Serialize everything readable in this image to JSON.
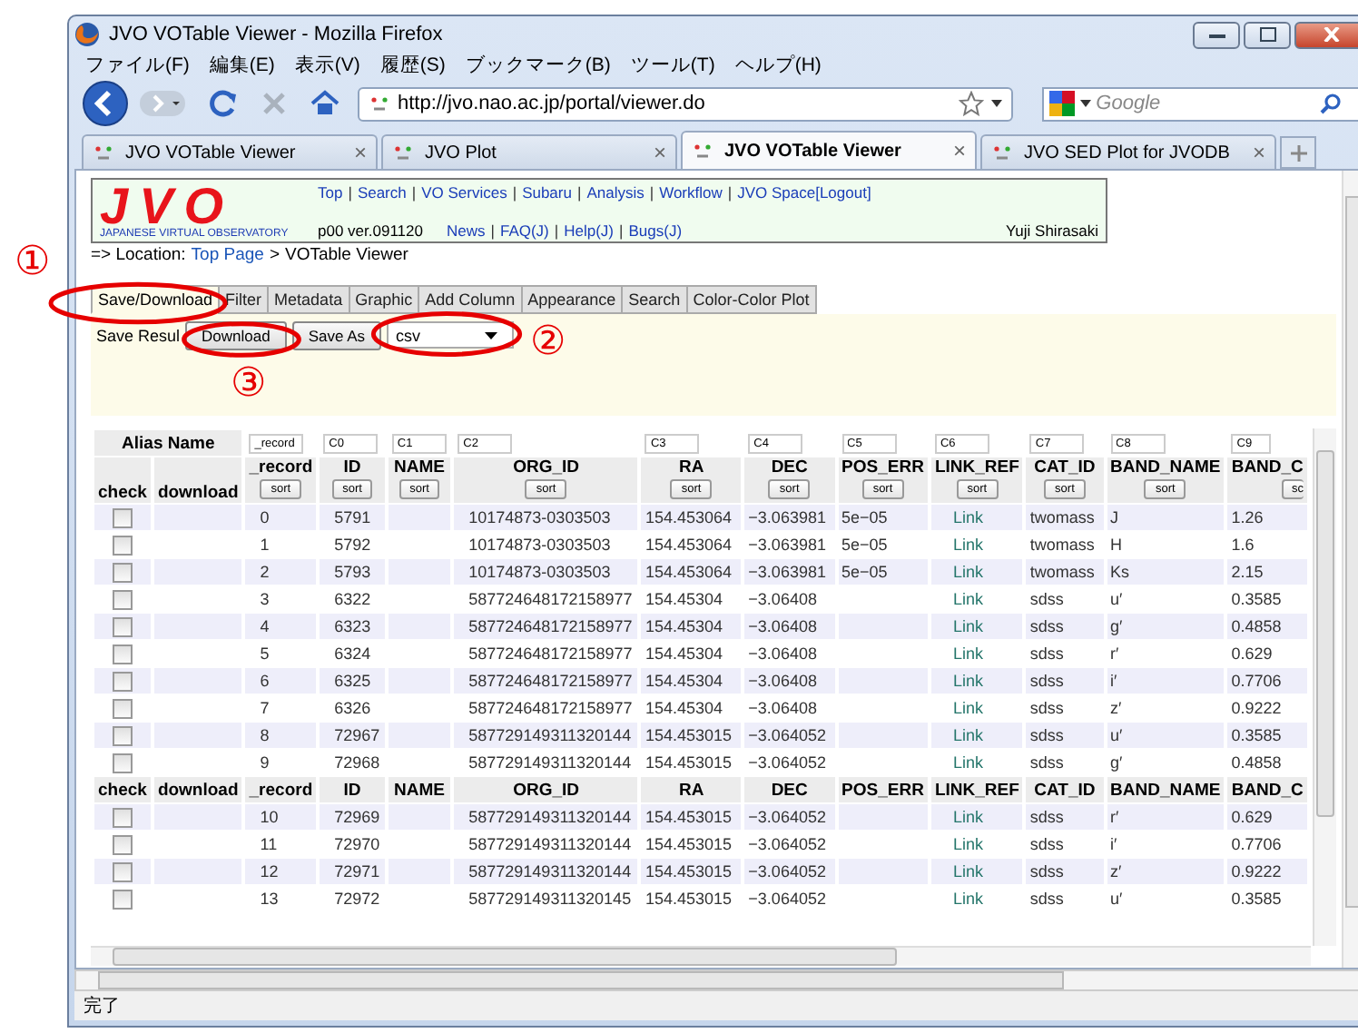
{
  "window": {
    "title": "JVO VOTable Viewer - Mozilla Firefox"
  },
  "menu": [
    "ファイル(F)",
    "編集(E)",
    "表示(V)",
    "履歴(S)",
    "ブックマーク(B)",
    "ツール(T)",
    "ヘルプ(H)"
  ],
  "address": {
    "value": "http://jvo.nao.ac.jp/portal/viewer.do"
  },
  "search": {
    "placeholder": "Google"
  },
  "browser_tabs": [
    {
      "label": "JVO VOTable Viewer",
      "close": "×",
      "selected": false
    },
    {
      "label": "JVO Plot",
      "close": "×",
      "selected": false
    },
    {
      "label": "JVO VOTable Viewer",
      "close": "×",
      "selected": true
    },
    {
      "label": "JVO SED Plot for JVODB",
      "close": "×",
      "selected": false
    }
  ],
  "site": {
    "logo": "JVO",
    "logo_subtitle": "JAPANESE VIRTUAL OBSERVATORY",
    "separator": "|",
    "nav_links": [
      "Top",
      "Search",
      "VO Services",
      "Subaru",
      "Analysis",
      "Workflow",
      "JVO Space[Logout]"
    ],
    "version": "p00 ver.091120",
    "sub_links": [
      "News",
      "FAQ(J)",
      "Help(J)",
      "Bugs(J)"
    ],
    "user": "Yuji Shirasaki"
  },
  "breadcrumb": {
    "prefix": "=> Location:",
    "items": [
      "Top Page",
      "VOTable Viewer"
    ],
    "separator": ">"
  },
  "tabs": [
    {
      "label": "Save/Download",
      "selected": true
    },
    {
      "label": "Filter",
      "selected": false
    },
    {
      "label": "Metadata",
      "selected": false
    },
    {
      "label": "Graphic",
      "selected": false
    },
    {
      "label": "Add Column",
      "selected": false
    },
    {
      "label": "Appearance",
      "selected": false
    },
    {
      "label": "Search",
      "selected": false
    },
    {
      "label": "Color-Color Plot",
      "selected": false
    }
  ],
  "save": {
    "label": "Save Resul",
    "download": "Download",
    "save_as": "Save As",
    "format": "csv"
  },
  "table": {
    "alias_label": "Alias Name",
    "fixed_headers": [
      "check",
      "download"
    ],
    "columns": [
      {
        "alias": "_record",
        "label": "_record",
        "sort": "sort"
      },
      {
        "alias": "C0",
        "label": "ID",
        "sort": "sort"
      },
      {
        "alias": "C1",
        "label": "NAME",
        "sort": "sort"
      },
      {
        "alias": "C2",
        "label": "ORG_ID",
        "sort": "sort"
      },
      {
        "alias": "C3",
        "label": "RA",
        "sort": "sort"
      },
      {
        "alias": "C4",
        "label": "DEC",
        "sort": "sort"
      },
      {
        "alias": "C5",
        "label": "POS_ERR",
        "sort": "sort"
      },
      {
        "alias": "C6",
        "label": "LINK_REF",
        "sort": "sort"
      },
      {
        "alias": "C7",
        "label": "CAT_ID",
        "sort": "sort"
      },
      {
        "alias": "C8",
        "label": "BAND_NAME",
        "sort": "sort"
      },
      {
        "alias": "C9",
        "label": "BAND_C",
        "sort": "sc"
      }
    ],
    "rows": [
      {
        "kind": "data",
        "checked": false,
        "record": "0",
        "id": "5791",
        "org_id": "10174873-0303503",
        "ra": "154.453064",
        "dec": "−3.063981",
        "pos_err": "5e−05",
        "link_ref": "Link",
        "cat_id": "twomass",
        "band_name": "J",
        "band_c": "1.26"
      },
      {
        "kind": "data",
        "checked": false,
        "record": "1",
        "id": "5792",
        "org_id": "10174873-0303503",
        "ra": "154.453064",
        "dec": "−3.063981",
        "pos_err": "5e−05",
        "link_ref": "Link",
        "cat_id": "twomass",
        "band_name": "H",
        "band_c": "1.6"
      },
      {
        "kind": "data",
        "checked": false,
        "record": "2",
        "id": "5793",
        "org_id": "10174873-0303503",
        "ra": "154.453064",
        "dec": "−3.063981",
        "pos_err": "5e−05",
        "link_ref": "Link",
        "cat_id": "twomass",
        "band_name": "Ks",
        "band_c": "2.15"
      },
      {
        "kind": "data",
        "checked": false,
        "record": "3",
        "id": "6322",
        "org_id": "587724648172158977",
        "ra": "154.45304",
        "dec": "−3.06408",
        "link_ref": "Link",
        "cat_id": "sdss",
        "band_name": "u′",
        "band_c": "0.3585"
      },
      {
        "kind": "data",
        "checked": false,
        "record": "4",
        "id": "6323",
        "org_id": "587724648172158977",
        "ra": "154.45304",
        "dec": "−3.06408",
        "link_ref": "Link",
        "cat_id": "sdss",
        "band_name": "g′",
        "band_c": "0.4858"
      },
      {
        "kind": "data",
        "checked": false,
        "record": "5",
        "id": "6324",
        "org_id": "587724648172158977",
        "ra": "154.45304",
        "dec": "−3.06408",
        "link_ref": "Link",
        "cat_id": "sdss",
        "band_name": "r′",
        "band_c": "0.629"
      },
      {
        "kind": "data",
        "checked": false,
        "record": "6",
        "id": "6325",
        "org_id": "587724648172158977",
        "ra": "154.45304",
        "dec": "−3.06408",
        "link_ref": "Link",
        "cat_id": "sdss",
        "band_name": "i′",
        "band_c": "0.7706"
      },
      {
        "kind": "data",
        "checked": false,
        "record": "7",
        "id": "6326",
        "org_id": "587724648172158977",
        "ra": "154.45304",
        "dec": "−3.06408",
        "link_ref": "Link",
        "cat_id": "sdss",
        "band_name": "z′",
        "band_c": "0.9222"
      },
      {
        "kind": "data",
        "checked": false,
        "record": "8",
        "id": "72967",
        "org_id": "587729149311320144",
        "ra": "154.453015",
        "dec": "−3.064052",
        "link_ref": "Link",
        "cat_id": "sdss",
        "band_name": "u′",
        "band_c": "0.3585"
      },
      {
        "kind": "data",
        "checked": false,
        "record": "9",
        "id": "72968",
        "org_id": "587729149311320144",
        "ra": "154.453015",
        "dec": "−3.064052",
        "link_ref": "Link",
        "cat_id": "sdss",
        "band_name": "g′",
        "band_c": "0.4858"
      },
      {
        "kind": "header",
        "labels": [
          "check",
          "download",
          "_record",
          "ID",
          "NAME",
          "ORG_ID",
          "RA",
          "DEC",
          "POS_ERR",
          "LINK_REF",
          "CAT_ID",
          "BAND_NAME",
          "BAND_C"
        ]
      },
      {
        "kind": "data",
        "checked": false,
        "record": "10",
        "id": "72969",
        "org_id": "587729149311320144",
        "ra": "154.453015",
        "dec": "−3.064052",
        "link_ref": "Link",
        "cat_id": "sdss",
        "band_name": "r′",
        "band_c": "0.629"
      },
      {
        "kind": "data",
        "checked": false,
        "record": "11",
        "id": "72970",
        "org_id": "587729149311320144",
        "ra": "154.453015",
        "dec": "−3.064052",
        "link_ref": "Link",
        "cat_id": "sdss",
        "band_name": "i′",
        "band_c": "0.7706"
      },
      {
        "kind": "data",
        "checked": false,
        "record": "12",
        "id": "72971",
        "org_id": "587729149311320144",
        "ra": "154.453015",
        "dec": "−3.064052",
        "link_ref": "Link",
        "cat_id": "sdss",
        "band_name": "z′",
        "band_c": "0.9222"
      },
      {
        "kind": "data",
        "checked": false,
        "record": "13",
        "id": "72972",
        "org_id": "587729149311320145",
        "ra": "154.453015",
        "dec": "−3.064052",
        "link_ref": "Link",
        "cat_id": "sdss",
        "band_name": "u′",
        "band_c": "0.3585"
      }
    ]
  },
  "status_bar": {
    "text": "完了"
  },
  "annotations": [
    {
      "label": "①"
    },
    {
      "label": "②"
    },
    {
      "label": "③"
    }
  ]
}
